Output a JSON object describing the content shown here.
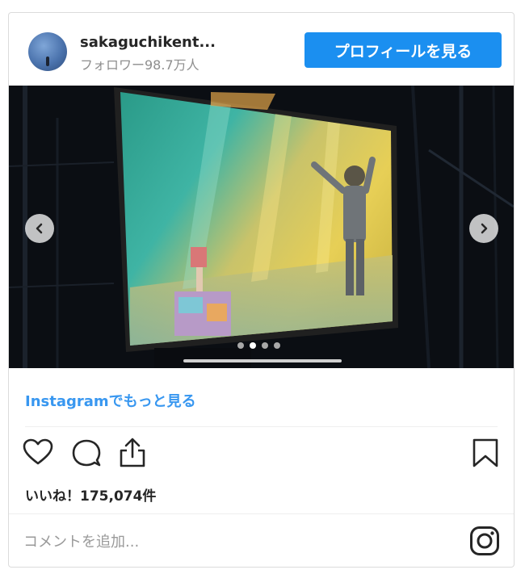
{
  "header": {
    "username": "sakaguchikent...",
    "followers": "フォロワー98.7万人",
    "profile_button": "プロフィールを見る"
  },
  "media": {
    "carousel_index": 2,
    "carousel_count": 4,
    "prev_icon": "chevron-left-icon",
    "next_icon": "chevron-right-icon"
  },
  "more_link": "Instagramでもっと見る",
  "actions": {
    "icons": [
      "heart-icon",
      "comment-icon",
      "share-icon",
      "bookmark-icon"
    ]
  },
  "likes": "いいね！175,074件",
  "comment": {
    "placeholder": "コメントを追加..."
  },
  "colors": {
    "accent": "#1b8ff0",
    "link": "#3897f0",
    "border": "#dbdbdb"
  }
}
